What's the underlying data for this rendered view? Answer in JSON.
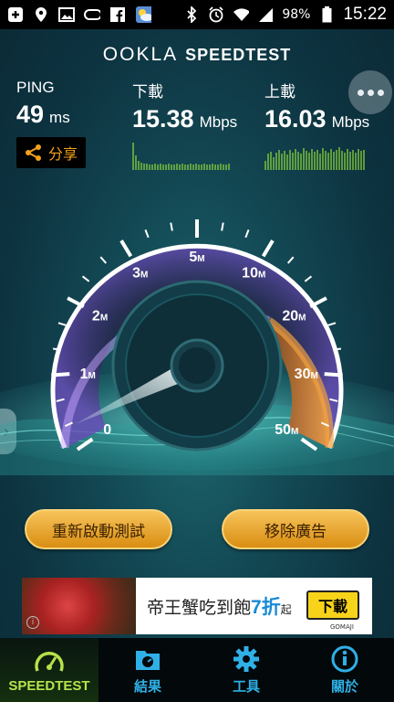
{
  "status_bar": {
    "battery": "98%",
    "time": "15:22",
    "left_icons": [
      "plus-icon",
      "location-icon",
      "image-icon",
      "device-icon",
      "facebook-icon",
      "weather-icon"
    ],
    "right_icons": [
      "bluetooth-icon",
      "alarm-icon",
      "wifi-icon",
      "signal-icon",
      "battery-icon"
    ]
  },
  "header": {
    "logo_main": "OOKLA",
    "logo_sub": "SPEEDTEST"
  },
  "stats": {
    "ping": {
      "label": "PING",
      "value": "49",
      "unit": "ms"
    },
    "download": {
      "label": "下載",
      "value": "15.38",
      "unit": "Mbps"
    },
    "upload": {
      "label": "上載",
      "value": "16.03",
      "unit": "Mbps"
    }
  },
  "share": {
    "label": "分享"
  },
  "gauge": {
    "ticks": [
      {
        "num": "0",
        "unit": ""
      },
      {
        "num": "1",
        "unit": "M"
      },
      {
        "num": "2",
        "unit": "M"
      },
      {
        "num": "3",
        "unit": "M"
      },
      {
        "num": "5",
        "unit": "M"
      },
      {
        "num": "10",
        "unit": "M"
      },
      {
        "num": "20",
        "unit": "M"
      },
      {
        "num": "30",
        "unit": "M"
      },
      {
        "num": "50",
        "unit": "M"
      }
    ],
    "needle_value": "0.3",
    "accent_color": "#f0a040",
    "ring_color": "#a06ee8"
  },
  "actions": {
    "restart": "重新啟動測試",
    "remove_ads": "移除廣告"
  },
  "ad": {
    "text": "帝王蟹吃到飽",
    "highlight": "7折",
    "suffix": "起",
    "download": "下載",
    "brand": "GOMAJI",
    "info": "i"
  },
  "nav": {
    "items": [
      {
        "label": "SPEEDTEST",
        "icon": "speedometer-icon"
      },
      {
        "label": "結果",
        "icon": "results-icon"
      },
      {
        "label": "工具",
        "icon": "gear-icon"
      },
      {
        "label": "關於",
        "icon": "info-icon"
      }
    ]
  }
}
